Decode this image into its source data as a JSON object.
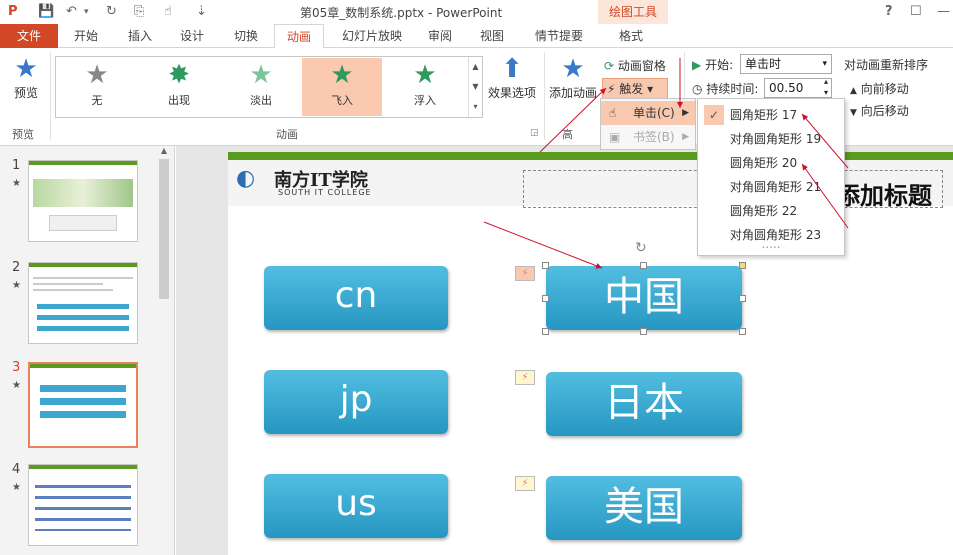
{
  "window": {
    "title": "第05章_数制系统.pptx - PowerPoint",
    "help": "?",
    "minimize": "—",
    "close": "✕",
    "restore": "☐"
  },
  "tabs": [
    "文件",
    "开始",
    "插入",
    "设计",
    "切换",
    "动画",
    "幻灯片放映",
    "审阅",
    "视图",
    "情节提要",
    "格式"
  ],
  "context_tab": "绘图工具",
  "ribbon": {
    "preview": {
      "label": "预览",
      "group": "预览"
    },
    "gallery": {
      "items": [
        "无",
        "出现",
        "淡出",
        "飞入",
        "浮入"
      ],
      "selected": "飞入",
      "group": "动画"
    },
    "effect_options": "效果选项",
    "add_animation": "添加动画",
    "animation_pane": "动画窗格",
    "trigger": "触发",
    "advanced_group": "高",
    "start_label": "开始:",
    "start_value": "单击时",
    "duration_label": "持续时间:",
    "duration_value": "00.50",
    "reorder_title": "对动画重新排序",
    "move_earlier": "向前移动",
    "move_later": "向后移动"
  },
  "trigger_menu": {
    "items": [
      "单击(C)",
      "书签(B)"
    ]
  },
  "shape_menu": {
    "items": [
      "圆角矩形 17",
      "对角圆角矩形 19",
      "圆角矩形 20",
      "对角圆角矩形 21",
      "圆角矩形 22",
      "对角圆角矩形 23"
    ],
    "checked": "圆角矩形 17",
    "more": "....."
  },
  "slides": [
    {
      "num": "1",
      "star": "★"
    },
    {
      "num": "2",
      "star": "★"
    },
    {
      "num": "3",
      "star": "★"
    },
    {
      "num": "4",
      "star": "★"
    }
  ],
  "slide": {
    "logo_text": "南方IT学院",
    "logo_sub": "SOUTH IT COLLEGE",
    "title_partial": "添加标题",
    "codes": [
      "cn",
      "jp",
      "us"
    ],
    "countries": [
      "中国",
      "日本",
      "美国"
    ]
  },
  "colors": {
    "accent": "#d24726",
    "button": "#2c9ec9",
    "green": "#5a9a1e"
  }
}
